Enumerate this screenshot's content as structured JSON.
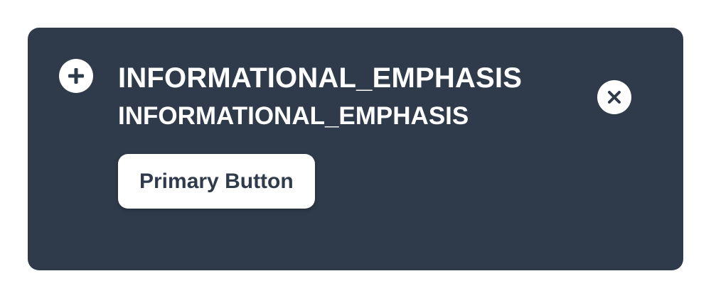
{
  "banner": {
    "variant": "INFORMATIONAL_EMPHASIS",
    "title": "INFORMATIONAL_EMPHASIS",
    "message": "INFORMATIONAL_EMPHASIS",
    "primary_button_label": "Primary Button",
    "lead_icon": "plus-circle-icon",
    "close_icon": "close-circle-icon",
    "colors": {
      "background": "#2f3b4a",
      "text": "#ffffff",
      "button_background": "#ffffff",
      "button_text": "#2f3b4a"
    }
  }
}
